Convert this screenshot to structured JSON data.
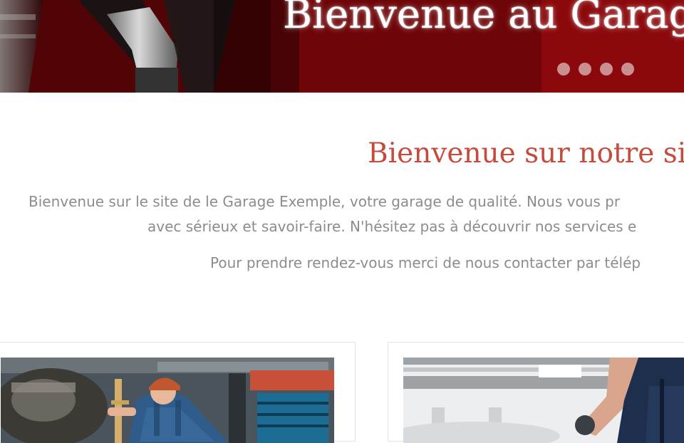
{
  "hero": {
    "title": "Bienvenue au Garage",
    "slides": [
      "slide-1",
      "slide-2",
      "slide-3",
      "slide-4"
    ]
  },
  "intro": {
    "heading": "Bienvenue sur notre sit",
    "line1": "Bienvenue sur le site de le Garage Exemple, votre garage de qualité. Nous vous pr",
    "line2": "avec sérieux et savoir-faire. N'hésitez pas à découvrir nos services e",
    "line3": "Pour prendre rendez-vous merci de nous contacter par télép"
  },
  "colors": {
    "accent": "#c54b3c",
    "hero_red": "#8a0a0c",
    "body_text": "#8c8c8c"
  }
}
